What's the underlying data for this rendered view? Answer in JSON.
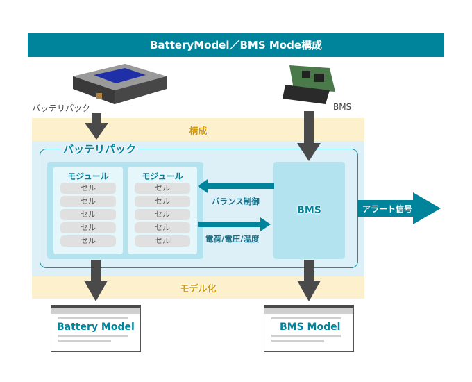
{
  "header": {
    "title": "BatteryModel／BMS Mode構成"
  },
  "images": {
    "battery_pack": {
      "label": "バッテリパック",
      "icon": "battery-pack-image"
    },
    "bms": {
      "label": "BMS",
      "icon": "bms-board-image"
    }
  },
  "bands": {
    "top": "構成",
    "bottom": "モデル化"
  },
  "battery_pack": {
    "title": "バッテリパック",
    "modules": [
      {
        "title": "モジュール",
        "cells": [
          "セル",
          "セル",
          "セル",
          "セル",
          "セル"
        ]
      },
      {
        "title": "モジュール",
        "cells": [
          "セル",
          "セル",
          "セル",
          "セル",
          "セル"
        ]
      }
    ]
  },
  "bms_block": {
    "label": "BMS"
  },
  "flows": {
    "to_pack": "バランス制御",
    "to_bms": "電荷/電圧/温度",
    "output": "アラート信号"
  },
  "outputs": {
    "battery_model": "Battery Model",
    "bms_model": "BMS Model"
  },
  "colors": {
    "accent": "#00849c",
    "band": "#fdf0cc",
    "band_text": "#d49a00",
    "area": "#ddeff7",
    "module_bg": "#b3e3ee",
    "arrow_dark": "#4a4a4a"
  }
}
